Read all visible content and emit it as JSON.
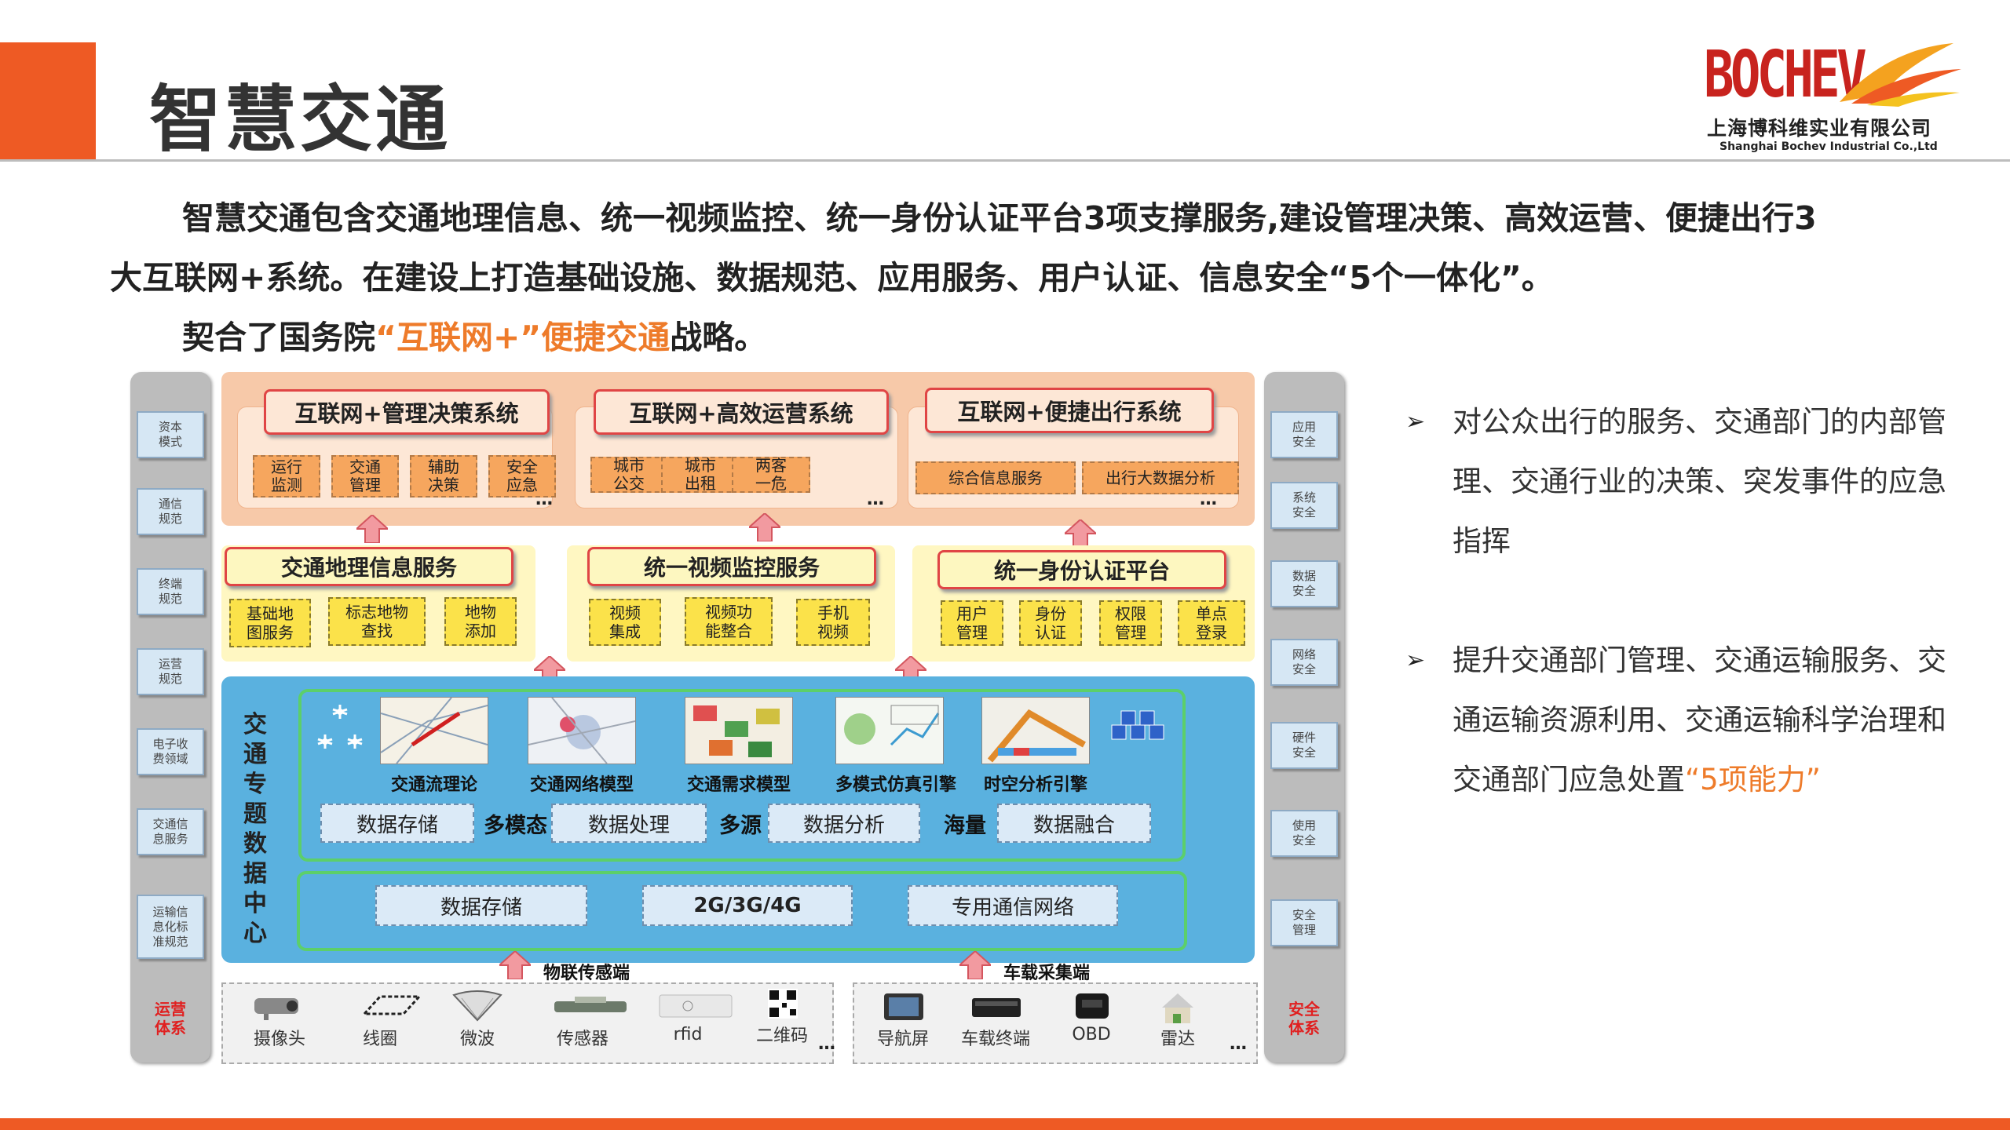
{
  "header": {
    "title": "智慧交通",
    "logo_word": "BOCHEV",
    "logo_company_cn": "上海博科维实业有限公司",
    "logo_company_en": "Shanghai Bochev Industrial Co.,Ltd"
  },
  "intro": {
    "line1": "智慧交通包含交通地理信息、统一视频监控、统一身份认证平台3项支撑服务,建设管理决策、高效运营、便捷出行3",
    "line2": "大互联网+系统。在建设上打造基础设施、数据规范、应用服务、用户认证、信息安全“5个一体化”。",
    "line3_prefix": "契合了国务院",
    "line3_highlight": "“互联网+”便捷交通",
    "line3_suffix": "战略。"
  },
  "left_rail": {
    "items": [
      "资本\n模式",
      "通信\n规范",
      "终端\n规范",
      "运营\n规范",
      "电子收\n费领域",
      "交通信\n息服务",
      "运输信\n息化标\n准规范"
    ],
    "footer": "运营\n体系"
  },
  "right_rail": {
    "items": [
      "应用\n安全",
      "系统\n安全",
      "数据\n安全",
      "网络\n安全",
      "硬件\n安全",
      "使用\n安全",
      "安全\n管理"
    ],
    "footer": "安全\n体系"
  },
  "systems": [
    {
      "title": "互联网+管理决策系统",
      "items": [
        "运行\n监测",
        "交通\n管理",
        "辅助\n决策",
        "安全\n应急"
      ]
    },
    {
      "title": "互联网+高效运营系统",
      "items": [
        "城市\n公交",
        "城市\n出租",
        "两客\n一危"
      ]
    },
    {
      "title": "互联网+便捷出行系统",
      "items": [
        "综合信息服务",
        "出行大数据分析"
      ]
    }
  ],
  "ellipsis": "…",
  "services": [
    {
      "title": "交通地理信息服务",
      "items": [
        "基础地\n图服务",
        "标志地物\n查找",
        "地物\n添加"
      ]
    },
    {
      "title": "统一视频监控服务",
      "items": [
        "视频\n集成",
        "视频功\n能整合",
        "手机\n视频"
      ]
    },
    {
      "title": "统一身份认证平台",
      "items": [
        "用户\n管理",
        "身份\n认证",
        "权限\n管理",
        "单点\n登录"
      ]
    }
  ],
  "data_center": {
    "label": "交\n通\n专\n题\n数\n据\n中\n心",
    "models": [
      "交通流理论",
      "交通网络模型",
      "交通需求模型",
      "多模式仿真引擎",
      "时空分析引擎"
    ],
    "process_buttons": [
      "数据存储",
      "数据处理",
      "数据分析",
      "数据融合"
    ],
    "process_words": [
      "多模态",
      "多源",
      "海量"
    ],
    "network_buttons": [
      "数据存储",
      "2G/3G/4G",
      "专用通信网络"
    ]
  },
  "terminals": {
    "iot_label": "物联传感端",
    "vehicle_label": "车载采集端",
    "iot_devices": [
      "摄像头",
      "线圈",
      "微波",
      "传感器",
      "rfid",
      "二维码"
    ],
    "vehicle_devices": [
      "导航屏",
      "车载终端",
      "OBD",
      "雷达"
    ]
  },
  "bullets": [
    {
      "text": "对公众出行的服务、交通部门的内部管理、交通行业的决策、突发事件的应急指挥",
      "highlight": ""
    },
    {
      "text": "提升交通部门管理、交通运输服务、交通运输资源利用、交通运输科学治理和交通部门应急处置",
      "highlight": "“5项能力”"
    }
  ],
  "colors": {
    "accent_orange": "#ee5a24",
    "highlight_orange": "#ee7b2a",
    "blue_zone": "#5ab1df",
    "red_border": "#e04545"
  }
}
